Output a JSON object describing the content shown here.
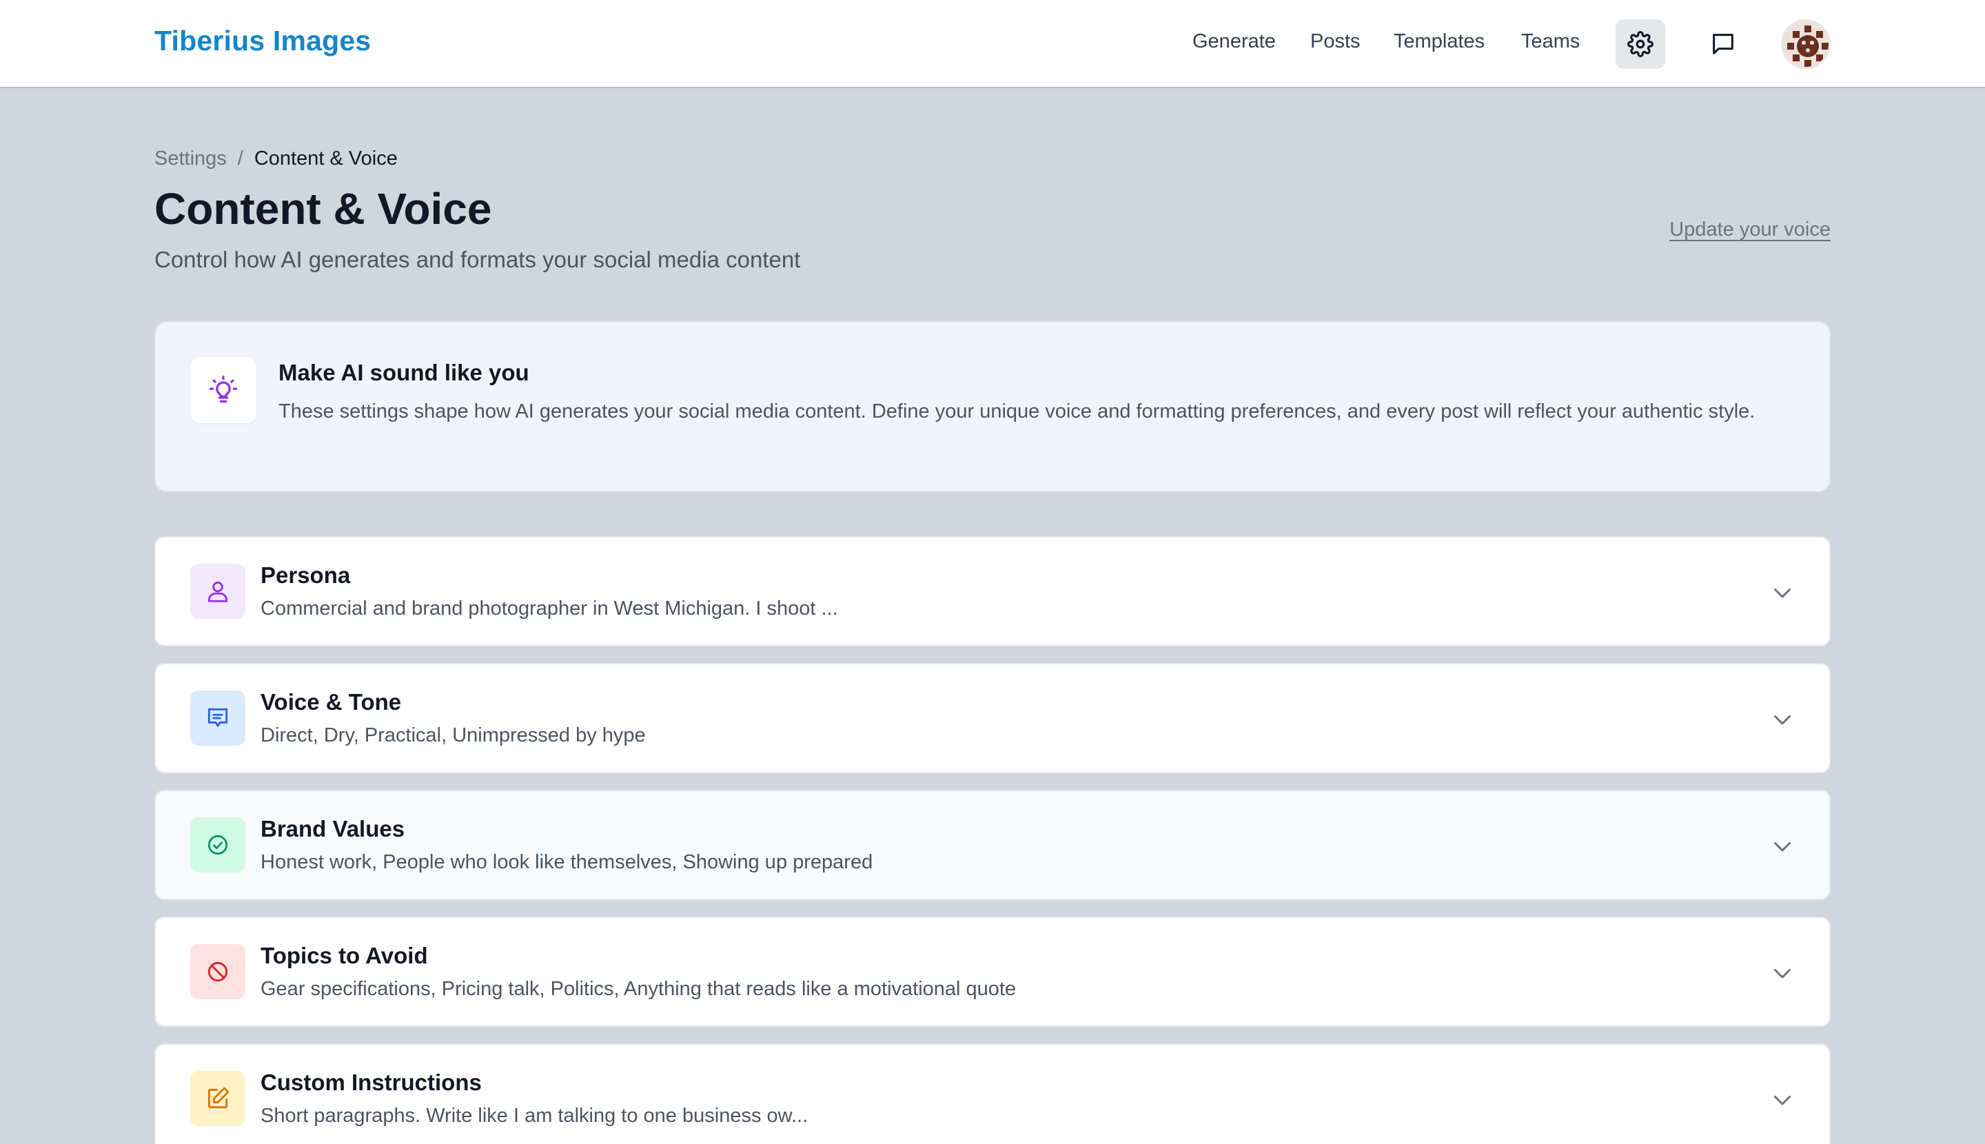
{
  "app": {
    "brand": "Tiberius Images"
  },
  "nav": {
    "items": [
      "Generate",
      "Posts",
      "Templates",
      "Teams"
    ]
  },
  "header_icons": {
    "settings": "gear-icon",
    "messages": "chat-bubble-icon",
    "profile": "avatar"
  },
  "breadcrumb": {
    "parent": "Settings",
    "separator": "/",
    "current": "Content & Voice"
  },
  "page": {
    "title": "Content & Voice",
    "subtitle": "Control how AI generates and formats your social media content",
    "update_link": "Update your voice"
  },
  "info": {
    "icon": "lightbulb-icon",
    "title": "Make AI sound like you",
    "body": "These settings shape how AI generates your social media content. Define your unique voice and formatting preferences, and every post will reflect your authentic style."
  },
  "sections": [
    {
      "title": "Persona",
      "summary": "Commercial and brand photographer in West Michigan. I shoot ...",
      "icon": "user-icon",
      "color": "#9333ea",
      "bg": "#f3e8ff"
    },
    {
      "title": "Voice & Tone",
      "summary": "Direct, Dry, Practical, Unimpressed by hype",
      "icon": "message-icon",
      "color": "#2563eb",
      "bg": "#dbeafe"
    },
    {
      "title": "Brand Values",
      "summary": "Honest work, People who look like themselves, Showing up prepared",
      "icon": "check-circle-icon",
      "color": "#059669",
      "bg": "#d1fae5"
    },
    {
      "title": "Topics to Avoid",
      "summary": "Gear specifications, Pricing talk, Politics, Anything that reads like a motivational quote",
      "icon": "ban-icon",
      "color": "#dc2626",
      "bg": "#fee2e2"
    },
    {
      "title": "Custom Instructions",
      "summary": "Short paragraphs. Write like I am talking to one business ow...",
      "icon": "edit-icon",
      "color": "#d97706",
      "bg": "#fef3c7"
    }
  ],
  "colors": {
    "brand": "#1686c8",
    "page_bg": "#d1d5de",
    "info_bg": "#f3f3fd"
  }
}
